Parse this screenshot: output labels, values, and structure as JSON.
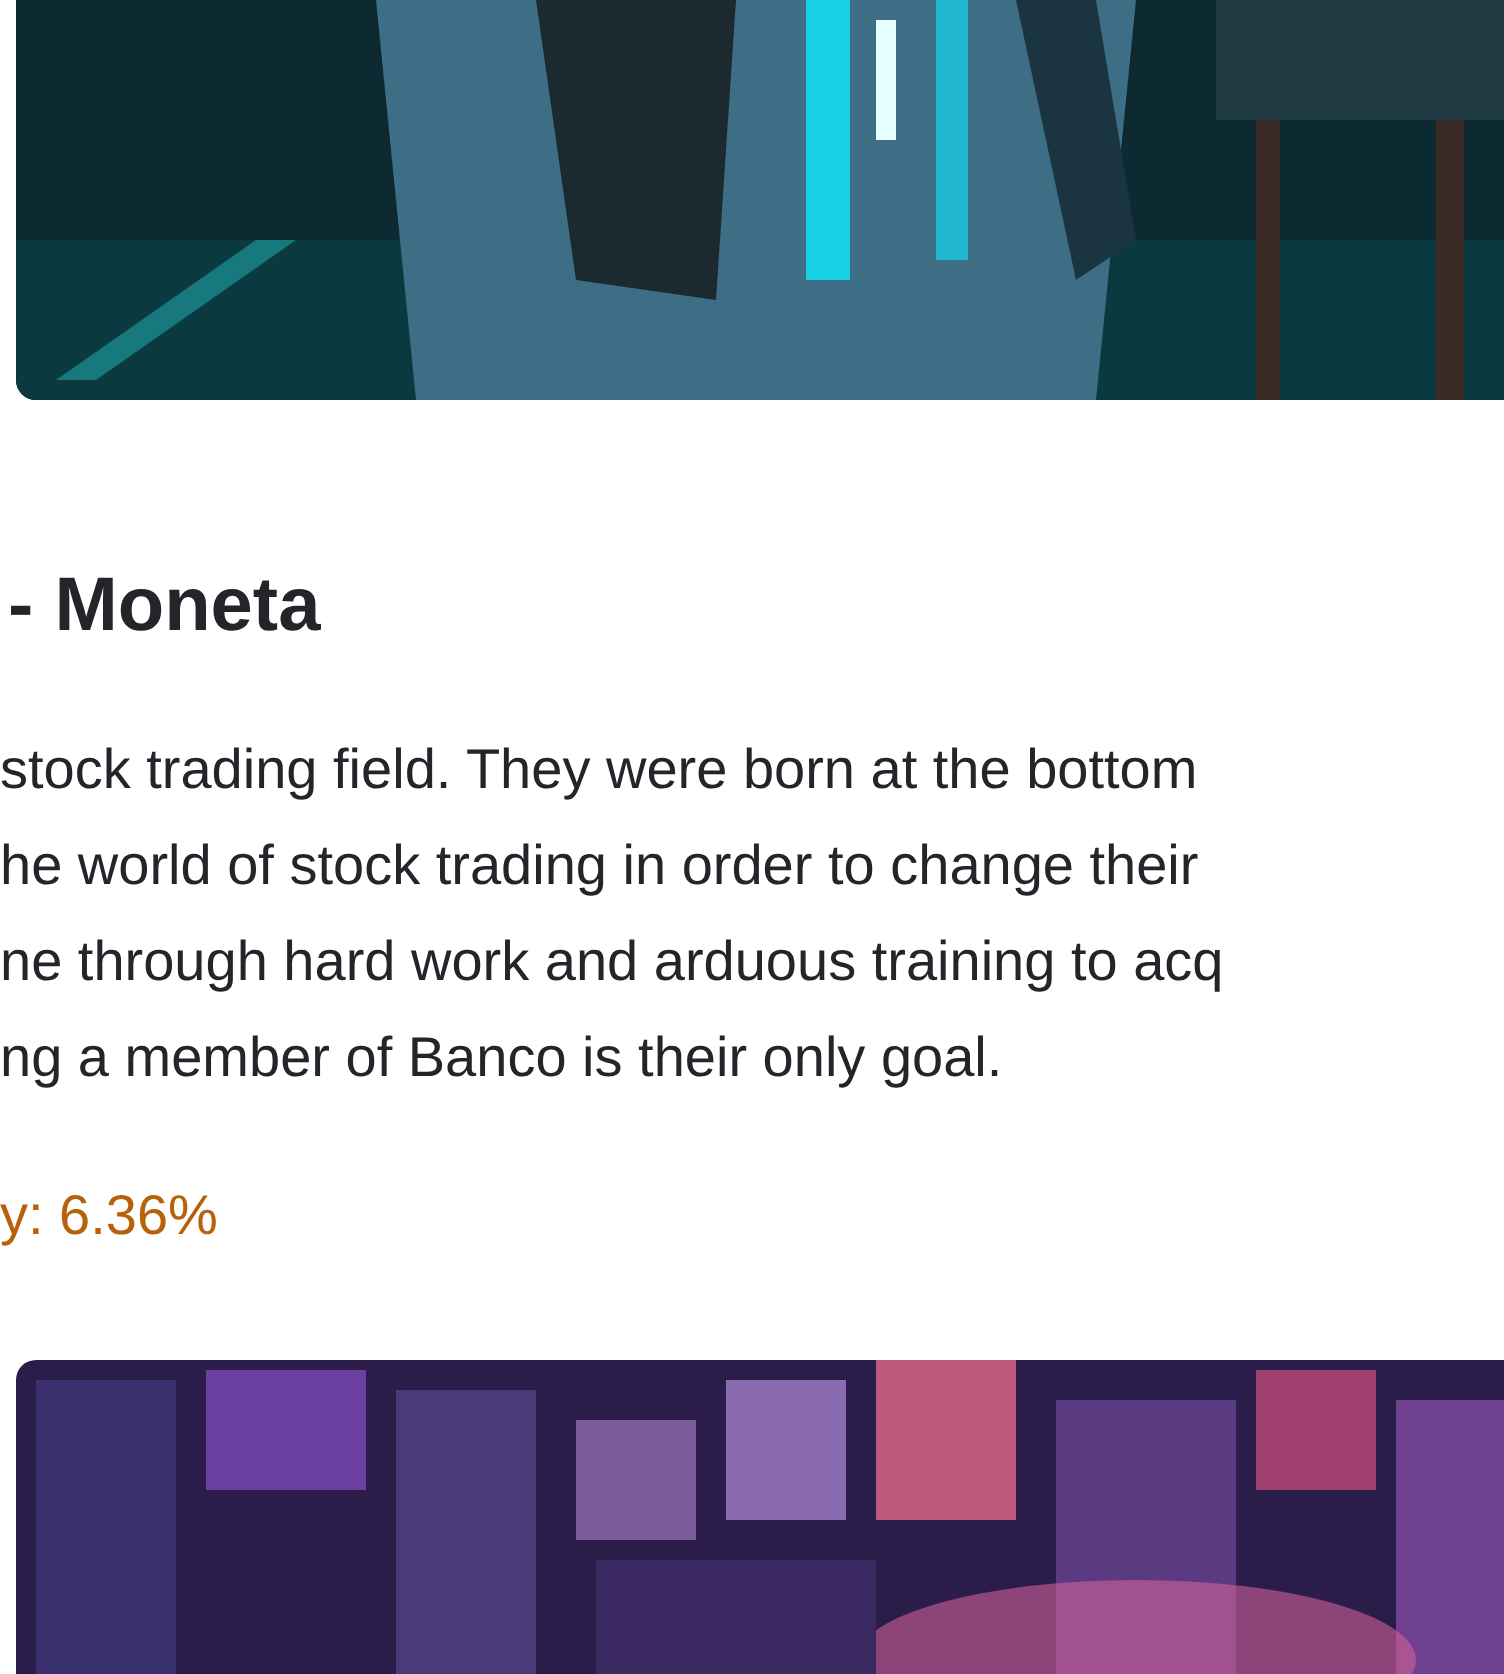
{
  "heading": "- Moneta",
  "paragraph_lines": [
    "stock trading field. They were born at the bottom",
    "he world of stock trading in order to change their",
    "ne through hard work and arduous training to acq",
    "ng a member of Banco is their only goal."
  ],
  "stat": "y: 6.36%"
}
